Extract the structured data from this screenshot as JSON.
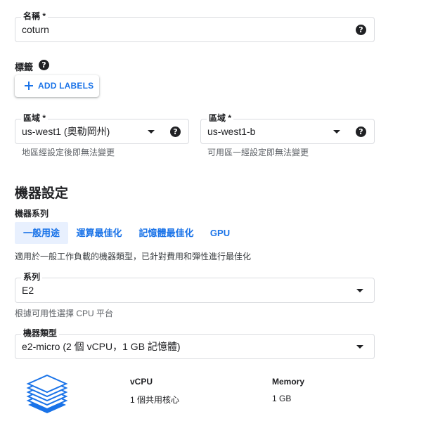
{
  "name_field": {
    "label": "名稱 *",
    "value": "coturn"
  },
  "labels": {
    "heading": "標籤",
    "add_button": "ADD LABELS"
  },
  "region_field": {
    "label": "區域 *",
    "value": "us-west1 (奧勒岡州)",
    "hint": "地區經設定後即無法變更"
  },
  "zone_field": {
    "label": "區域 *",
    "value": "us-west1-b",
    "hint": "可用區一經設定即無法變更"
  },
  "machine_config": {
    "title": "機器設定",
    "series_heading": "機器系列",
    "tabs": [
      {
        "label": "一般用途",
        "active": true
      },
      {
        "label": "運算最佳化",
        "active": false
      },
      {
        "label": "記憶體最佳化",
        "active": false
      },
      {
        "label": "GPU",
        "active": false
      }
    ],
    "description": "適用於一般工作負載的機器類型，已針對費用和彈性進行最佳化",
    "series_field": {
      "label": "系列",
      "value": "E2",
      "hint": "根據可用性選擇 CPU 平台"
    },
    "type_field": {
      "label": "機器類型",
      "value": "e2-micro (2 個 vCPU，1 GB 記憶體)"
    },
    "specs": [
      {
        "heading": "vCPU",
        "value": "1 個共用核心"
      },
      {
        "heading": "Memory",
        "value": "1 GB"
      }
    ]
  },
  "colors": {
    "accent": "#1a73e8",
    "active_tab_bg": "#e8f0fe",
    "border": "#dadce0"
  }
}
